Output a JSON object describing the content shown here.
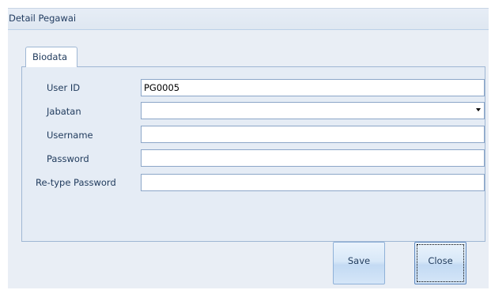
{
  "window": {
    "title": "Detail Pegawai"
  },
  "tabs": [
    {
      "label": "Biodata"
    }
  ],
  "form": {
    "fields": [
      {
        "label": "User ID",
        "value": "PG0005"
      },
      {
        "label": "Jabatan",
        "value": ""
      },
      {
        "label": "Username",
        "value": ""
      },
      {
        "label": "Password",
        "value": ""
      },
      {
        "label": "Re-type Password",
        "value": ""
      }
    ]
  },
  "buttons": {
    "save": "Save",
    "close": "Close"
  }
}
